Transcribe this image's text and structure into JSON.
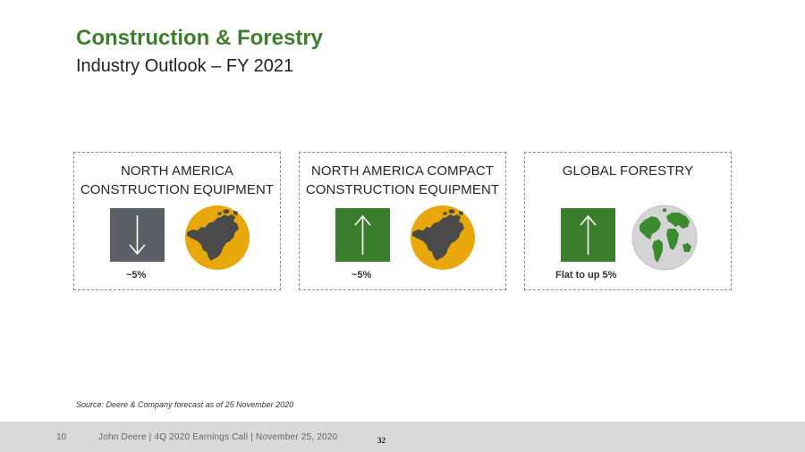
{
  "header": {
    "title": "Construction & Forestry",
    "subtitle": "Industry Outlook – FY 2021"
  },
  "cards": [
    {
      "title": "NORTH AMERICA\nCONSTRUCTION EQUIPMENT",
      "direction": "down",
      "arrow_icon": "arrow-down-icon",
      "arrow_color": "#5a6065",
      "map_icon": "north-america-map-icon",
      "value": "~5%"
    },
    {
      "title": "NORTH AMERICA COMPACT\nCONSTRUCTION EQUIPMENT",
      "direction": "up",
      "arrow_icon": "arrow-up-icon",
      "arrow_color": "#3a7d2c",
      "map_icon": "north-america-map-icon",
      "value": "~5%"
    },
    {
      "title": "GLOBAL FORESTRY",
      "direction": "up",
      "arrow_icon": "arrow-up-icon",
      "arrow_color": "#3a7d2c",
      "map_icon": "globe-icon",
      "value": "Flat to up 5%"
    }
  ],
  "source_note": "Source: Deere & Company forecast as of 25 November 2020",
  "footer": {
    "slide_number": "10",
    "text": "John Deere | 4Q 2020 Earnings Call | November 25, 2020",
    "page_number": "32"
  },
  "colors": {
    "brand_green": "#3e7d2c",
    "arrow_gray": "#5a6065",
    "map_gold": "#e8a70a",
    "map_land": "#4a4a4a",
    "globe_sea": "#d4d4d4",
    "globe_land": "#3c8a2e"
  }
}
